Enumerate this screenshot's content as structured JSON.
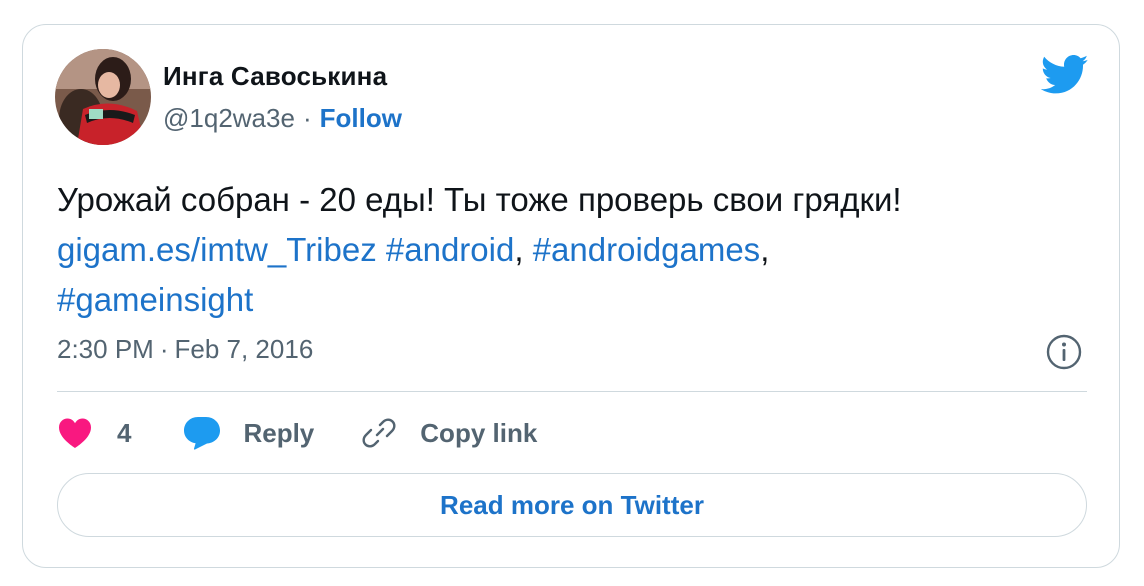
{
  "author": {
    "display_name": "Инга Савоськина",
    "handle": "@1q2wa3e",
    "separator": "·",
    "follow_label": "Follow"
  },
  "tweet": {
    "text_plain": "Урожай собран - 20 еды! Ты тоже проверь свои грядки!",
    "link_url_text": "gigam.es/imtw_Tribez",
    "hashtag_android": "#android",
    "comma1": ",",
    "hashtag_androidgames": "#androidgames",
    "comma2": ",",
    "hashtag_gameinsight": "#gameinsight"
  },
  "meta": {
    "time": "2:30 PM",
    "separator": "·",
    "date": "Feb 7, 2016"
  },
  "actions": {
    "like_count": "4",
    "reply_label": "Reply",
    "copy_link_label": "Copy link"
  },
  "footer": {
    "read_more_label": "Read more on Twitter"
  },
  "icons": {
    "logo": "twitter-bird-icon",
    "info": "info-icon",
    "like": "heart-icon",
    "reply": "speech-bubble-icon",
    "copy": "link-icon"
  },
  "colors": {
    "link": "#1d73c9",
    "heart": "#f91880",
    "reply_bubble": "#1d9bf0",
    "bird": "#1d9bf0",
    "secondary_text": "#536471",
    "border": "#cfd9de"
  }
}
